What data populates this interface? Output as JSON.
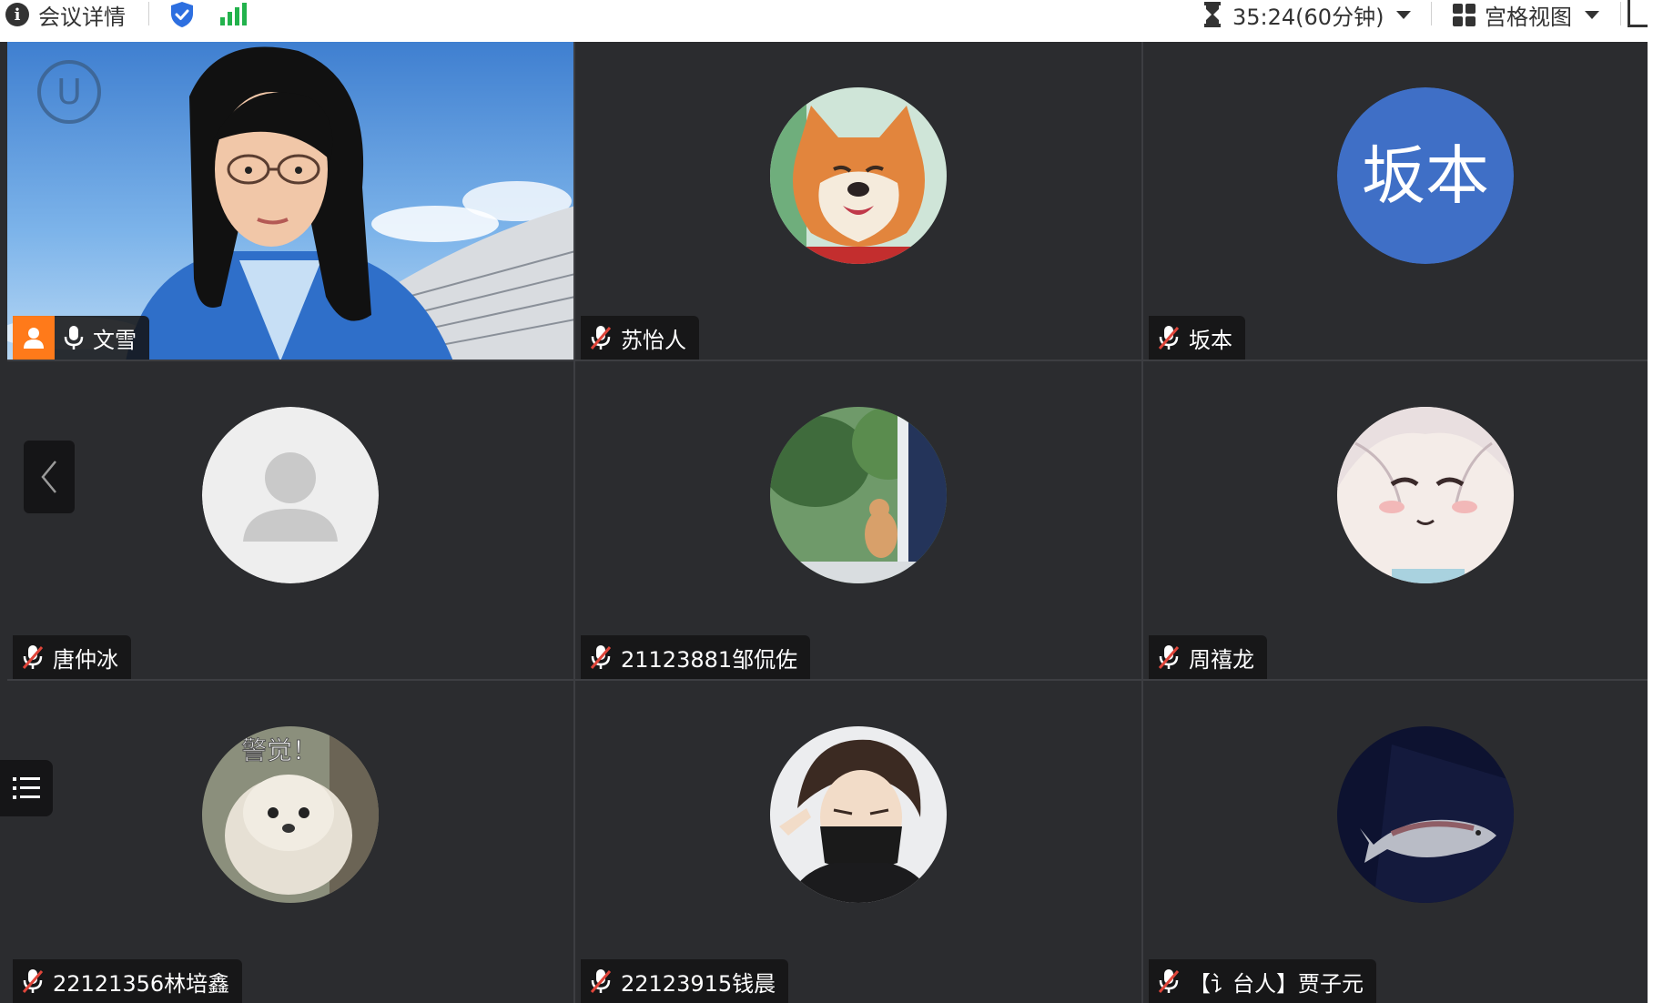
{
  "toolbar": {
    "meeting_details_label": "会议详情",
    "timer_text": "35:24(60分钟)",
    "view_mode_label": "宫格视图"
  },
  "participants": [
    {
      "name": "文雪",
      "video_on": true,
      "host": true,
      "mic": "on"
    },
    {
      "name": "苏怡人",
      "video_on": false,
      "mic": "muted",
      "avatar": "shiba-dog-cartoon"
    },
    {
      "name": "坂本",
      "video_on": false,
      "mic": "muted",
      "avatar_text": "坂本",
      "avatar_color": "#3f6fc6"
    },
    {
      "name": "唐仲冰",
      "video_on": false,
      "mic": "muted",
      "avatar": "default-person"
    },
    {
      "name": "21123881邹侃佐",
      "video_on": false,
      "mic": "muted",
      "avatar": "cat-photo"
    },
    {
      "name": "周禧龙",
      "video_on": false,
      "mic": "muted",
      "avatar": "anime-girl"
    },
    {
      "name": "22121356林培鑫",
      "video_on": false,
      "mic": "muted",
      "avatar": "dog-meme",
      "avatar_caption": "警觉！"
    },
    {
      "name": "22123915钱晨",
      "video_on": false,
      "mic": "muted",
      "avatar": "masked-character"
    },
    {
      "name": "【讠台人】贾子元",
      "video_on": false,
      "mic": "muted",
      "avatar": "fish-dark"
    }
  ],
  "colors": {
    "stage_bg": "#2b2c2f",
    "host_badge": "#ff7a1a",
    "signal_green": "#22b24c",
    "shield_blue": "#2d6fe0",
    "muted_red": "#e0453a"
  }
}
